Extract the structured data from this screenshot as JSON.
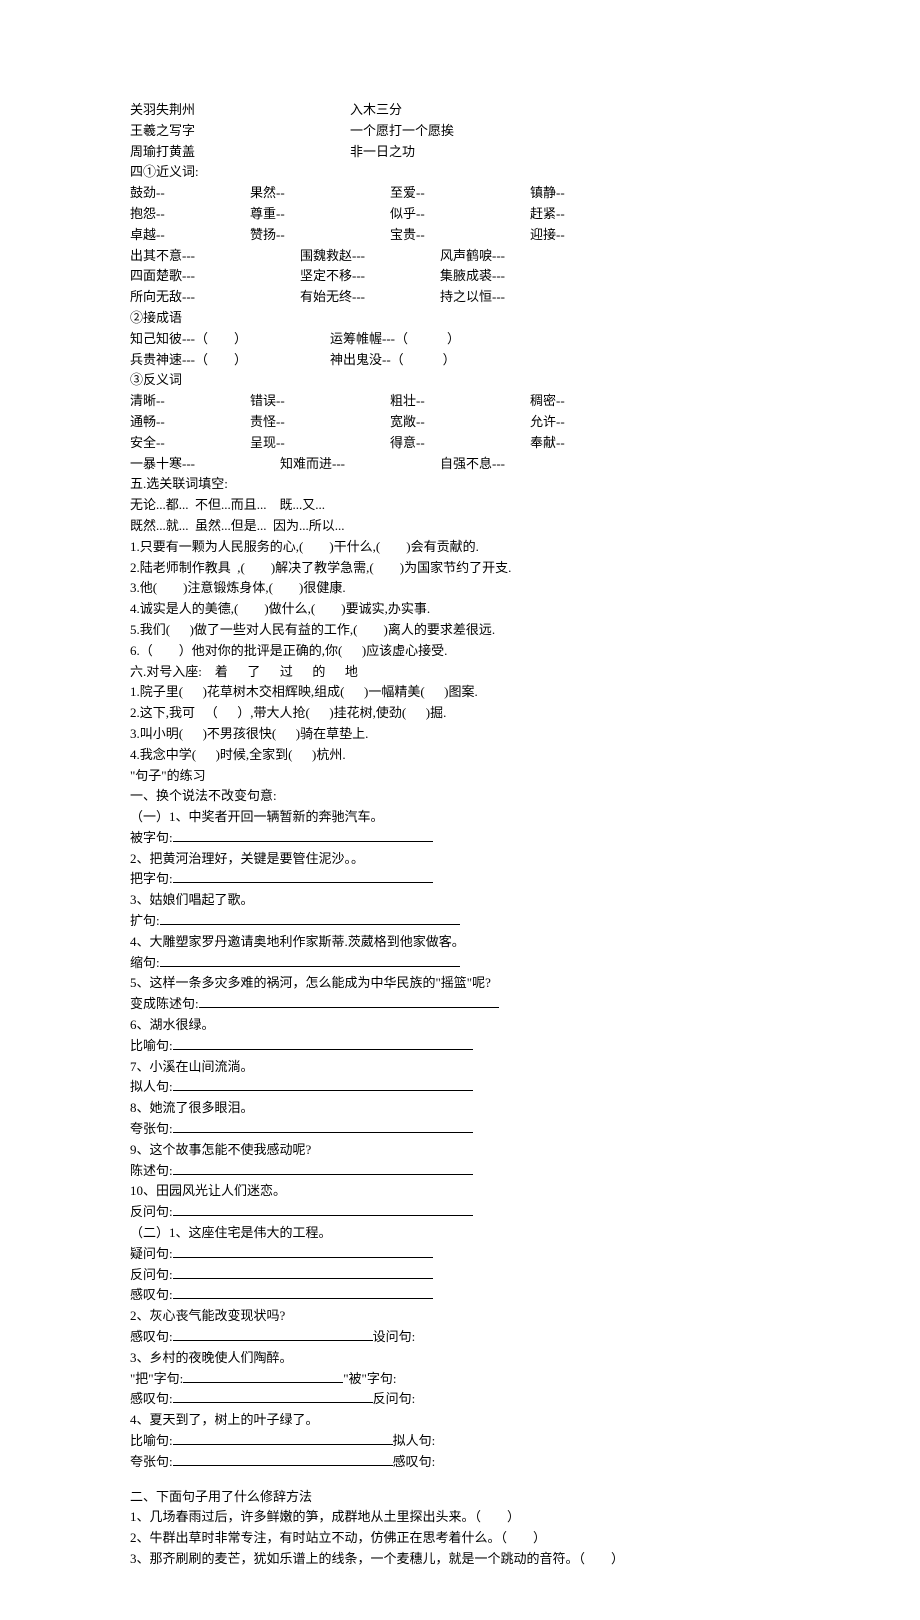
{
  "matching": {
    "left": [
      "关羽失荆州",
      "王羲之写字",
      "周瑜打黄盖"
    ],
    "right": [
      "入木三分",
      "一个愿打一个愿挨",
      "非一日之功"
    ]
  },
  "sec4": {
    "head": "四①近义词:",
    "syn_rows": [
      [
        "鼓劲--",
        "果然--",
        "至爱--",
        "镇静--"
      ],
      [
        "抱怨--",
        "尊重--",
        "似乎--",
        "赶紧--"
      ],
      [
        "卓越--",
        "赞扬--",
        "宝贵--",
        "迎接--"
      ]
    ],
    "idiom_rows": [
      [
        "出其不意---",
        "围魏救赵---",
        "风声鹤唳---"
      ],
      [
        "四面楚歌---",
        "坚定不移---",
        "集腋成裘---"
      ],
      [
        "所向无敌---",
        "有始无终---",
        "持之以恒---"
      ]
    ],
    "circle2": "②接成语",
    "chain_rows": [
      [
        "知己知彼---（        ）",
        "运筹帷幄---（            ）"
      ],
      [
        "兵贵神速---（        ）",
        "神出鬼没--（            ）"
      ]
    ],
    "circle3": "③反义词",
    "ant_rows": [
      [
        "清晰--",
        "错误--",
        "粗壮--",
        "稠密--"
      ],
      [
        "通畅--",
        "责怪--",
        "宽敞--",
        "允许--"
      ],
      [
        "安全--",
        "呈现--",
        "得意--",
        "奉献--"
      ]
    ],
    "ant_last": [
      "一暴十寒---",
      "知难而进---",
      "自强不息---"
    ]
  },
  "sec5": {
    "head": "五.选关联词填空:",
    "options": [
      "无论...都...  不但...而且...    既...又...",
      "既然...就...  虽然...但是...  因为...所以..."
    ],
    "items": [
      "1.只要有一颗为人民服务的心,(        )干什么,(        )会有贡献的.",
      "2.陆老师制作教具  ,(        )解决了教学急需,(        )为国家节约了开支.",
      "3.他(        )注意锻炼身体,(        )很健康.",
      "4.诚实是人的美德,(        )做什么,(        )要诚实,办实事.",
      "5.我们(      )做了一些对人民有益的工作,(        )离人的要求差很远.",
      "6.（        ）他对你的批评是正确的,你(      )应该虚心接受."
    ]
  },
  "sec6": {
    "head": "六.对号入座:    着      了      过      的      地",
    "items": [
      "1.院子里(      )花草树木交相辉映,组成(      )一幅精美(      )图案.",
      "2.这下,我可   （      ）,带大人抢(      )挂花树,使劲(      )掘.",
      "3.叫小明(      )不男孩很快(      )骑在草垫上.",
      "4.我念中学(      )时候,全家到(      )杭州."
    ]
  },
  "sentence": {
    "title": "\"句子\"的练习",
    "t1": "一、换个说法不改变句意:",
    "g1": {
      "head": "（一）1、中奖者开回一辆暂新的奔驰汽车。",
      "items": [
        {
          "label": "被字句:",
          "blank": 260
        },
        {
          "text": "2、把黄河治理好，关键是要管住泥沙。。"
        },
        {
          "label": "把字句:",
          "blank": 260
        },
        {
          "text": "3、姑娘们唱起了歌。"
        },
        {
          "label": "扩句:",
          "blank": 300
        },
        {
          "text": "4、大雕塑家罗丹邀请奥地利作家斯蒂.茨葳格到他家做客。"
        },
        {
          "label": "缩句:",
          "blank": 300
        },
        {
          "text": "5、这样一条多灾多难的祸河，怎么能成为中华民族的\"摇篮\"呢?"
        },
        {
          "label": "变成陈述句:",
          "blank": 300
        },
        {
          "text": "6、湖水很绿。"
        },
        {
          "label": "比喻句:",
          "blank": 300
        },
        {
          "text": "7、小溪在山间流淌。"
        },
        {
          "label": "拟人句:",
          "blank": 300
        },
        {
          "text": "8、她流了很多眼泪。"
        },
        {
          "label": "夸张句:",
          "blank": 300
        },
        {
          "text": "9、这个故事怎能不使我感动呢?"
        },
        {
          "label": "陈述句:",
          "blank": 300
        },
        {
          "text": "10、田园风光让人们迷恋。"
        },
        {
          "label": "反问句:",
          "blank": 300
        }
      ]
    },
    "g2": {
      "head": "（二）1、这座住宅是伟大的工程。",
      "items": [
        {
          "label": "疑问句:",
          "blank": 260
        },
        {
          "label": "反问句:",
          "blank": 260
        },
        {
          "label": "感叹句:",
          "blank": 260
        },
        {
          "text": "2、灰心丧气能改变现状吗?"
        },
        {
          "pair": [
            {
              "label": "感叹句:",
              "blank": 200
            },
            {
              "label": "设问句:",
              "blank": 0
            }
          ]
        },
        {
          "text": "3、乡村的夜晚使人们陶醉。"
        },
        {
          "pair": [
            {
              "label": "\"把\"字句:",
              "blank": 160
            },
            {
              "label": "\"被\"字句:",
              "blank": 0
            }
          ]
        },
        {
          "pair": [
            {
              "label": "感叹句:",
              "blank": 200
            },
            {
              "label": "反问句:",
              "blank": 0
            }
          ]
        },
        {
          "text": "4、夏天到了，树上的叶子绿了。"
        },
        {
          "pair": [
            {
              "label": "比喻句:",
              "blank": 220
            },
            {
              "label": "拟人句:",
              "blank": 0
            }
          ]
        },
        {
          "pair": [
            {
              "label": "夸张句:",
              "blank": 220
            },
            {
              "label": "感叹句:",
              "blank": 0
            }
          ]
        }
      ]
    }
  },
  "rhet": {
    "head": "二、下面句子用了什么修辞方法",
    "items": [
      "1、几场春雨过后，许多鲜嫩的笋，成群地从土里探出头来。（        ）",
      "2、牛群出草时非常专注，有时站立不动，仿佛正在思考着什么。（        ）",
      "3、那齐刷刷的麦芒，犹如乐谱上的线条，一个麦穗儿，就是一个跳动的音符。（        ）"
    ]
  }
}
